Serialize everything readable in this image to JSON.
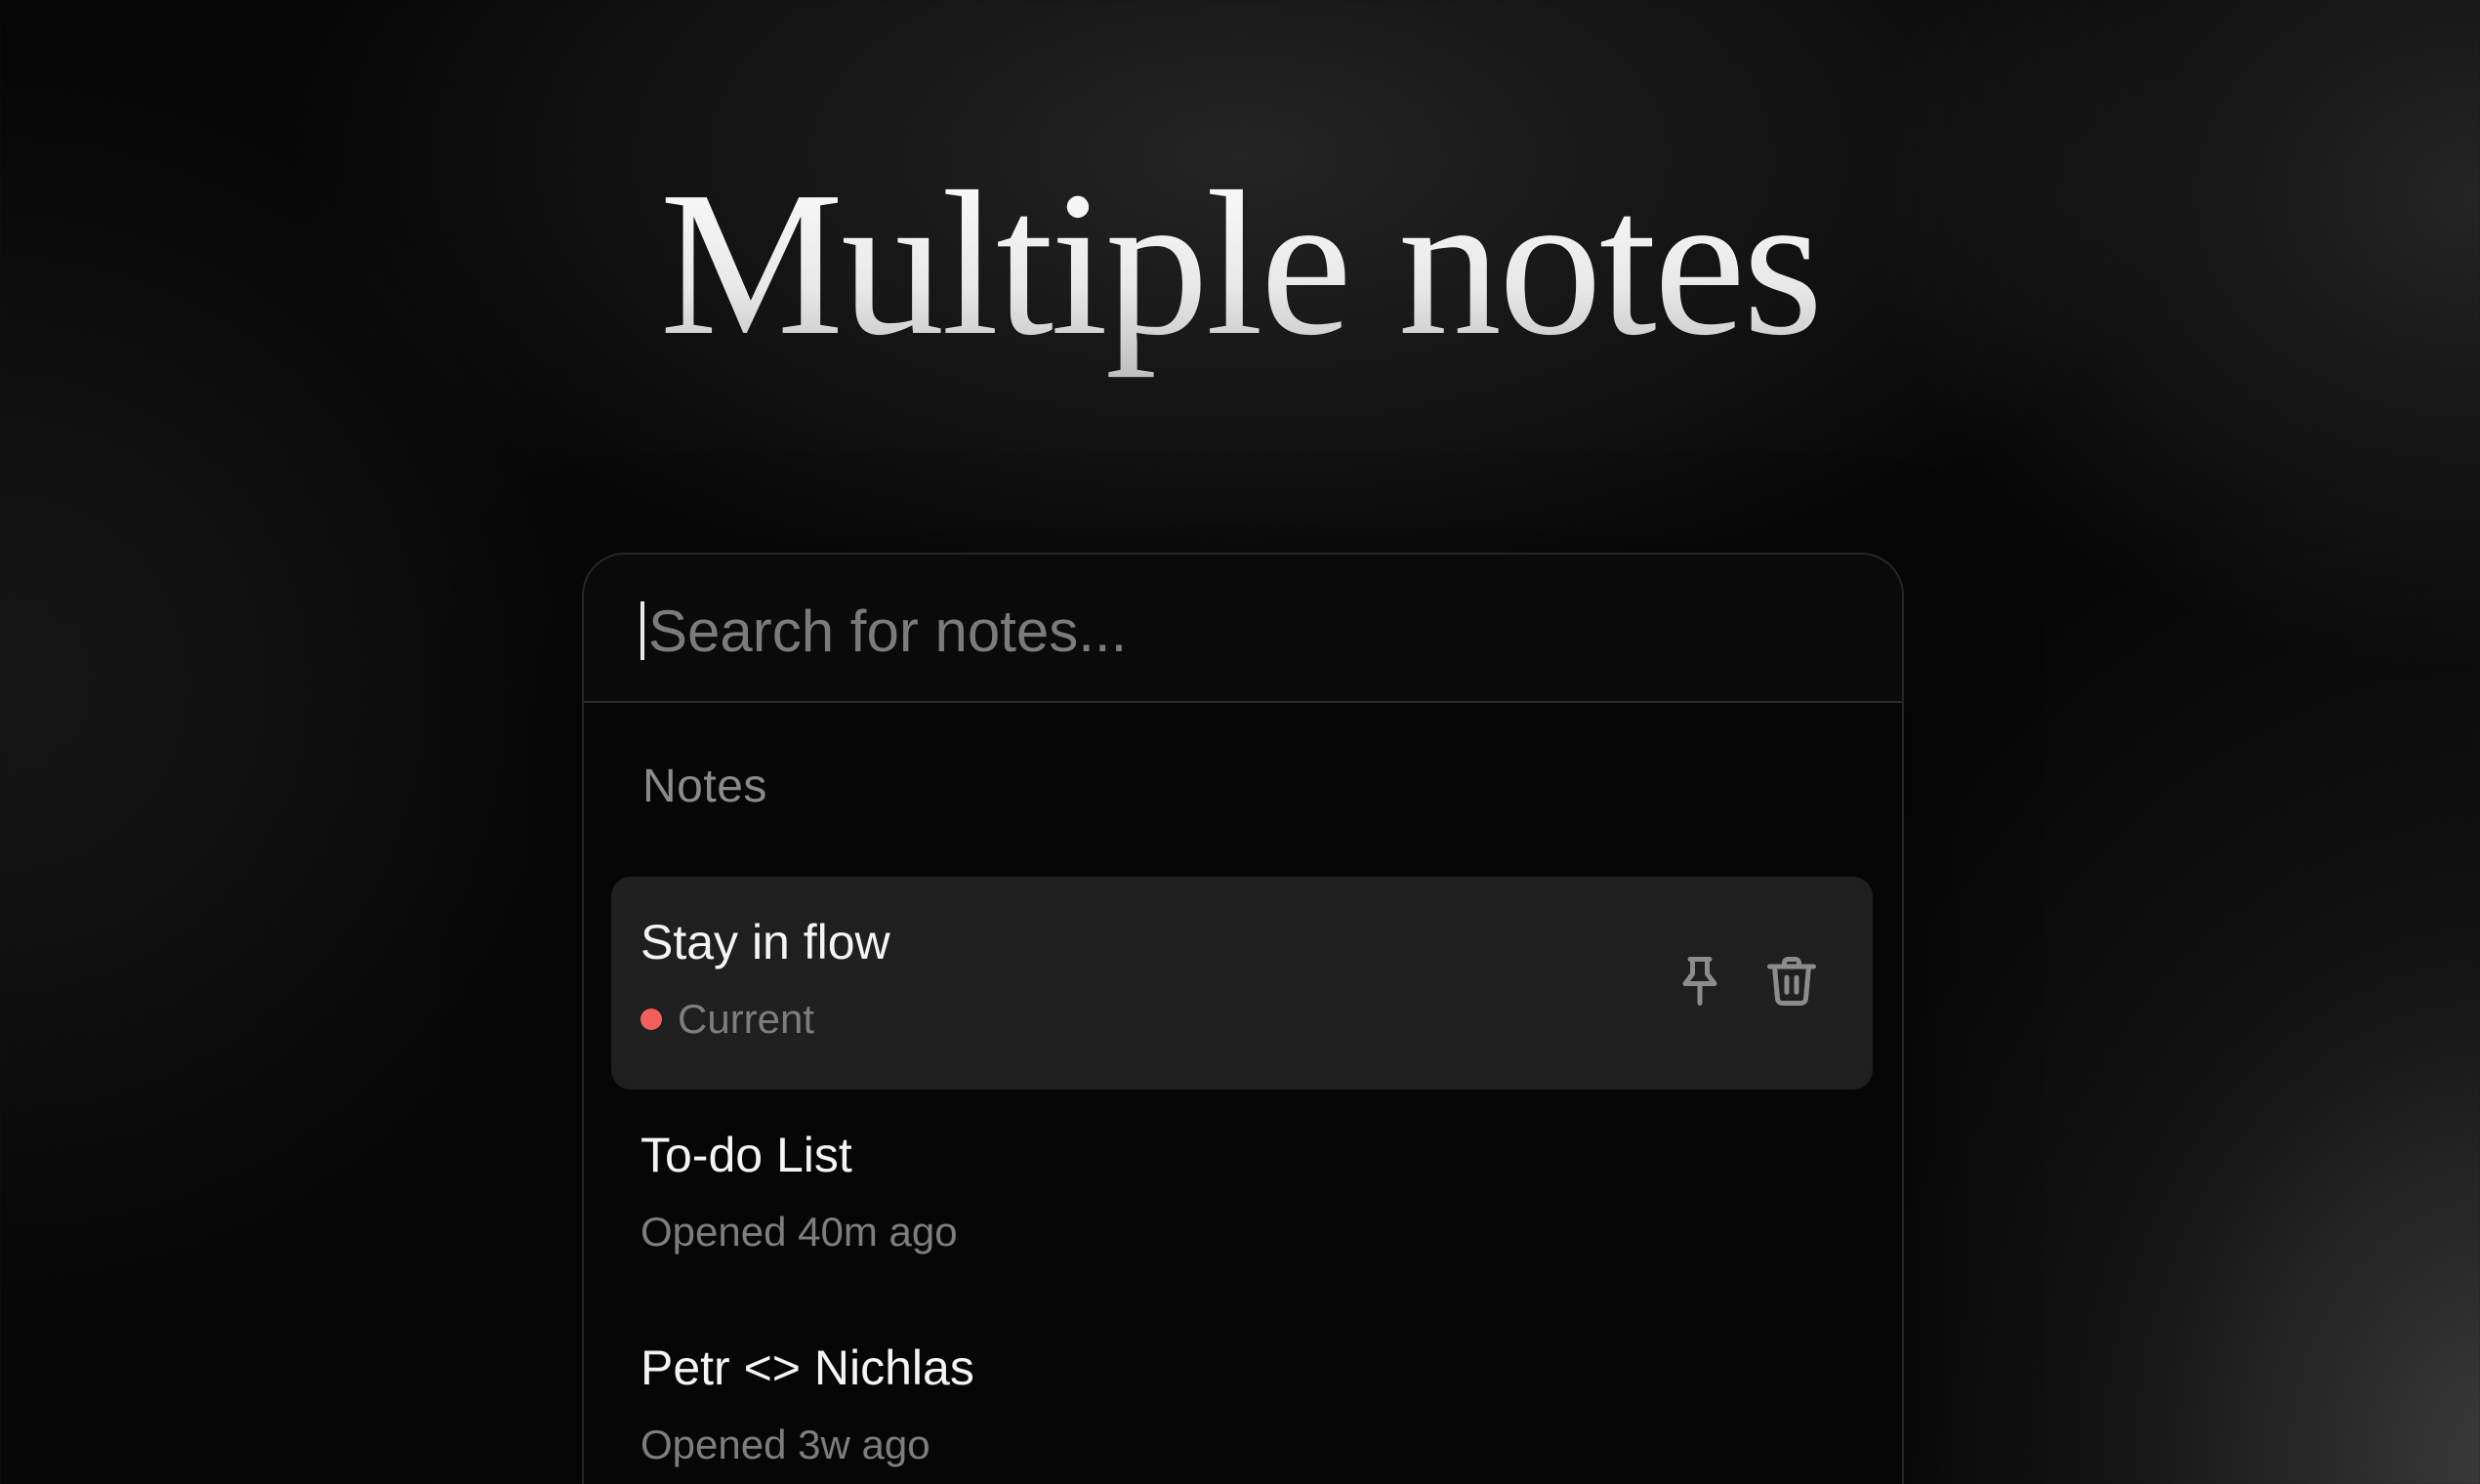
{
  "hero": {
    "title": "Multiple notes"
  },
  "search": {
    "value": "",
    "placeholder": "Search for notes..."
  },
  "list": {
    "section_label": "Notes",
    "items": [
      {
        "title": "Stay in flow",
        "meta": "Current",
        "active": true,
        "status_color": "#f25f5c",
        "actions": [
          {
            "icon": "pin-icon"
          },
          {
            "icon": "trash-icon"
          }
        ]
      },
      {
        "title": "To-do List",
        "meta": "Opened 40m ago",
        "active": false
      },
      {
        "title": "Petr <> Nichlas",
        "meta": "Opened 3w ago",
        "active": false
      }
    ]
  },
  "colors": {
    "background": "#070707",
    "panel": "#060606",
    "active_row": "#1f1f1f",
    "current_dot": "#f25f5c",
    "muted_text": "#7d7d7d"
  }
}
